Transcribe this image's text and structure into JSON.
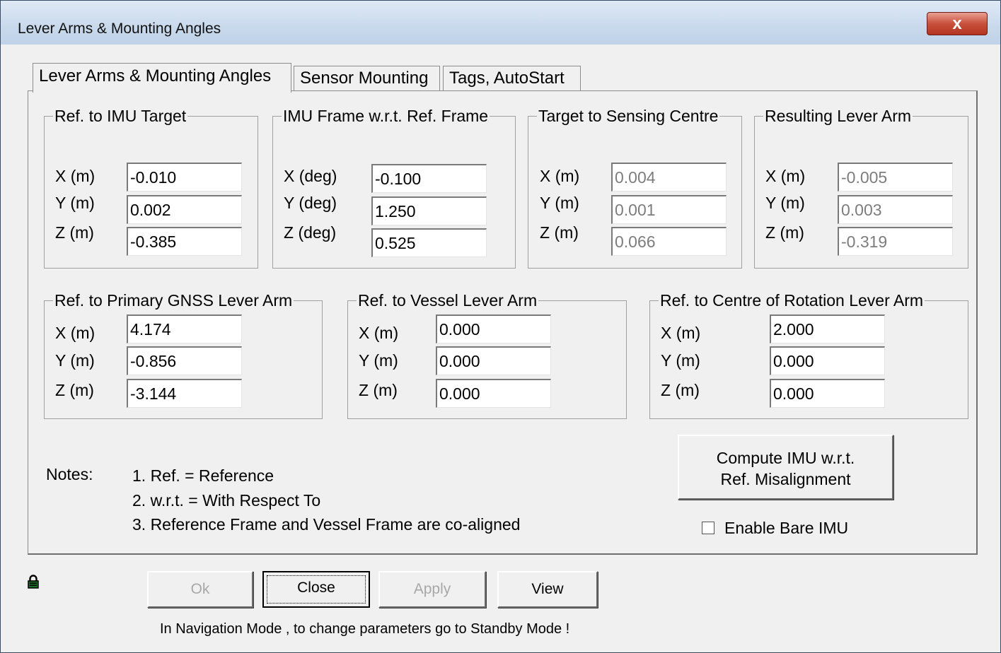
{
  "window": {
    "title": "Lever Arms & Mounting Angles",
    "close_glyph": "x"
  },
  "tabs": [
    "Lever Arms & Mounting Angles",
    "Sensor Mounting",
    "Tags, AutoStart"
  ],
  "groups": {
    "ref_imu_target": {
      "title": "Ref. to IMU Target",
      "labels": [
        "X (m)",
        "Y (m)",
        "Z (m)"
      ],
      "values": [
        "-0.010",
        "0.002",
        "-0.385"
      ]
    },
    "imu_frame": {
      "title": "IMU Frame w.r.t. Ref. Frame",
      "labels": [
        "X (deg)",
        "Y (deg)",
        "Z (deg)"
      ],
      "values": [
        "-0.100",
        "1.250",
        "0.525"
      ]
    },
    "target_sensing": {
      "title": "Target to Sensing Centre",
      "labels": [
        "X (m)",
        "Y (m)",
        "Z (m)"
      ],
      "values": [
        "0.004",
        "0.001",
        "0.066"
      ]
    },
    "resulting": {
      "title": "Resulting Lever Arm",
      "labels": [
        "X (m)",
        "Y (m)",
        "Z (m)"
      ],
      "values": [
        "-0.005",
        "0.003",
        "-0.319"
      ]
    },
    "gnss": {
      "title": "Ref. to Primary GNSS Lever Arm",
      "labels": [
        "X (m)",
        "Y (m)",
        "Z (m)"
      ],
      "values": [
        "4.174",
        "-0.856",
        "-3.144"
      ]
    },
    "vessel": {
      "title": "Ref. to Vessel Lever Arm",
      "labels": [
        "X (m)",
        "Y (m)",
        "Z (m)"
      ],
      "values": [
        "0.000",
        "0.000",
        "0.000"
      ]
    },
    "rotation": {
      "title": "Ref. to Centre of Rotation Lever Arm",
      "labels": [
        "X (m)",
        "Y (m)",
        "Z (m)"
      ],
      "values": [
        "2.000",
        "0.000",
        "0.000"
      ]
    }
  },
  "compute_button": {
    "line1": "Compute IMU w.r.t.",
    "line2": "Ref. Misalignment"
  },
  "bare_imu": {
    "label": "Enable Bare IMU",
    "checked": false
  },
  "notes": {
    "label": "Notes:",
    "items": [
      "1. Ref. = Reference",
      "2. w.r.t. = With Respect To",
      "3. Reference Frame and Vessel Frame are co-aligned"
    ]
  },
  "buttons": {
    "ok": "Ok",
    "close": "Close",
    "apply": "Apply",
    "view": "View"
  },
  "status": "In Navigation Mode , to change parameters go to Standby Mode !",
  "icons": {
    "lock": "lock-icon"
  }
}
